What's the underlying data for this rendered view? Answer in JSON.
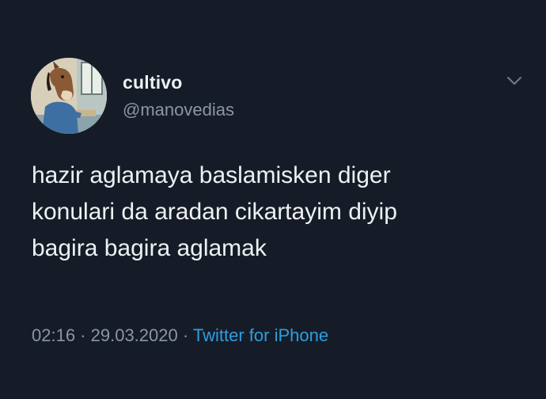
{
  "user": {
    "display_name": "cultivo",
    "handle": "@manovedias",
    "avatar_icon": "cartoon-horse-avatar"
  },
  "menu": {
    "icon": "chevron-down-icon"
  },
  "tweet": {
    "lines": [
      "hazir aglamaya baslamisken diger",
      "konulari da aradan cikartayim diyip",
      "bagira bagira aglamak"
    ]
  },
  "meta": {
    "time": "02:16",
    "separator": " · ",
    "date": "29.03.2020",
    "source": "Twitter for iPhone"
  },
  "colors": {
    "background": "#161c27",
    "text": "#eef1f4",
    "muted": "#8a96a3",
    "link": "#2d9ee0"
  }
}
